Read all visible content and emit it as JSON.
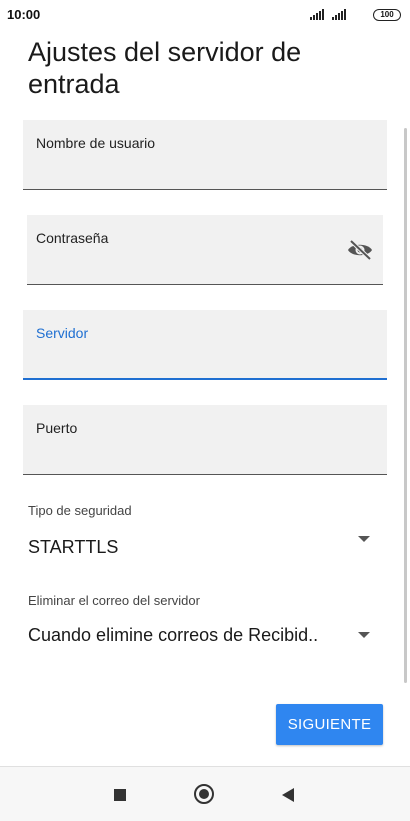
{
  "status_bar": {
    "time": "10:00",
    "battery": "100",
    "icons": [
      "signal-icon",
      "signal-icon",
      "battery-icon"
    ]
  },
  "page": {
    "title": "Ajustes del servidor de entrada"
  },
  "form": {
    "username": {
      "label": "Nombre de usuario",
      "value": ""
    },
    "password": {
      "label": "Contraseña",
      "value": "",
      "toggle_icon": "eye-off-icon"
    },
    "server": {
      "label": "Servidor",
      "value": "",
      "focused": true
    },
    "port": {
      "label": "Puerto",
      "value": ""
    },
    "security": {
      "label": "Tipo de seguridad",
      "value": "STARTTLS"
    },
    "delete_mail": {
      "label": "Eliminar el correo del servidor",
      "value": "Cuando elimine correos de Recibid.."
    }
  },
  "actions": {
    "next_label": "SIGUIENTE"
  },
  "nav_bar": {
    "icons": [
      "recents-icon",
      "home-icon",
      "back-icon"
    ]
  },
  "colors": {
    "accent": "#2f86f0",
    "focus": "#1f6fd1",
    "field_bg": "#f1f1f1"
  }
}
